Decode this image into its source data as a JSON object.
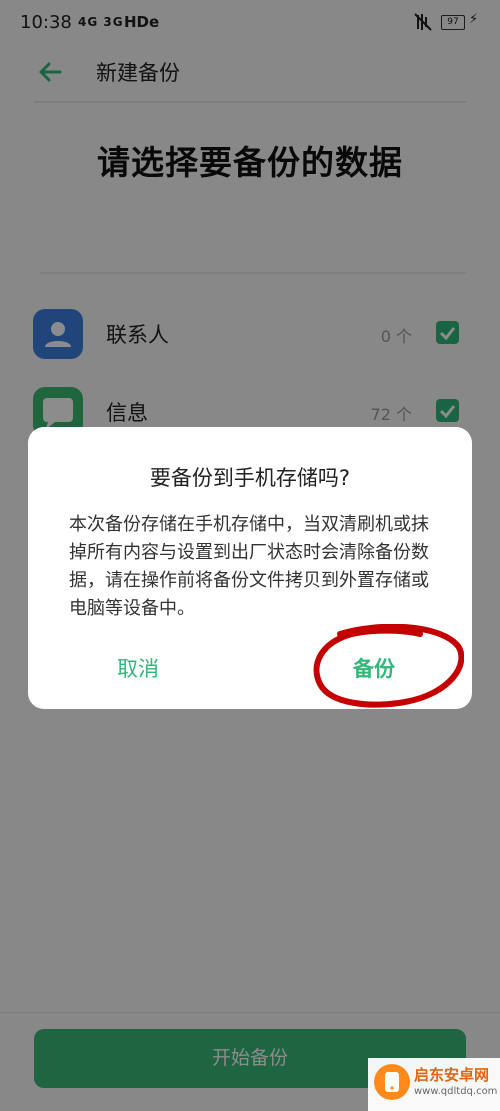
{
  "status_bar": {
    "time": "10:38",
    "network": "4G 3G",
    "hd": "HDe",
    "battery": "97",
    "icons": [
      "signal-icon",
      "mute-icon",
      "battery-icon",
      "charging-icon"
    ]
  },
  "header": {
    "back_icon": "arrow-left-icon",
    "title": "新建备份"
  },
  "heading": "请选择要备份的数据",
  "list": [
    {
      "label": "联系人",
      "count": "0 个",
      "checked": true,
      "icon": "contacts-icon",
      "color": "#3a7fe0"
    },
    {
      "label": "信息",
      "count": "72 个",
      "checked": true,
      "icon": "messages-icon",
      "color": "#39b970"
    }
  ],
  "dialog": {
    "title": "要备份到手机存储吗?",
    "body": "本次备份存储在手机存储中，当双清刷机或抹掉所有内容与设置到出厂状态时会清除备份数据，请在操作前将备份文件拷贝到外置存储或电脑等设备中。",
    "cancel": "取消",
    "confirm": "备份",
    "highlight_color": "#c40000"
  },
  "bottom": {
    "start_button": "开始备份"
  },
  "watermark": {
    "name": "启东安卓网",
    "url": "www.qdltdq.com"
  },
  "colors": {
    "accent": "#2fb87a",
    "scrim": "rgba(0,0,0,0.45)"
  }
}
